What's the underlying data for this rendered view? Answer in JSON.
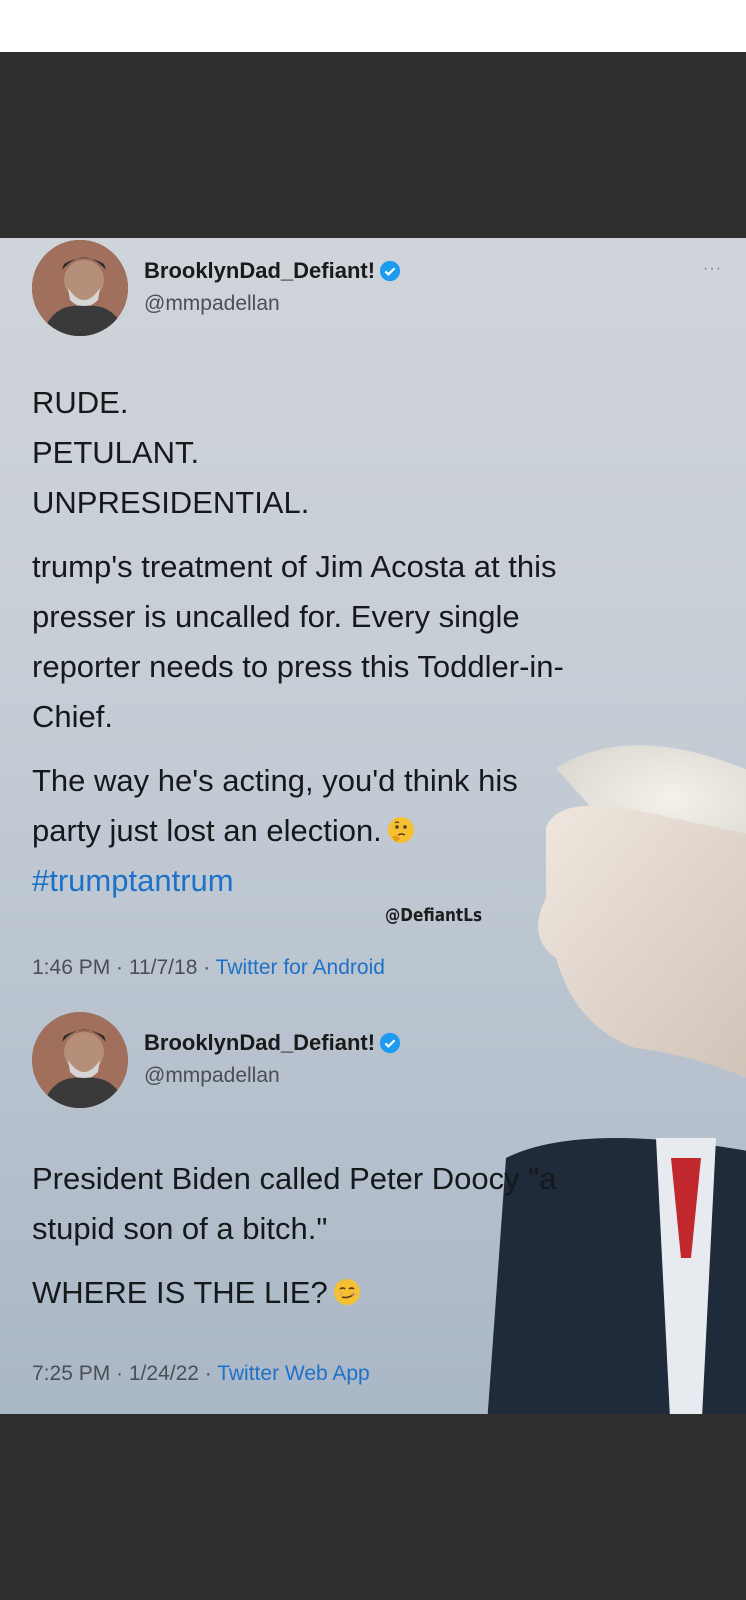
{
  "tweets": [
    {
      "display_name": "BrooklynDad_Defiant!",
      "handle": "@mmpadellan",
      "more": "···",
      "lines": [
        "RUDE.",
        "PETULANT.",
        "UNPRESIDENTIAL.",
        "trump's treatment of Jim Acosta at this",
        "presser is uncalled for. Every single",
        "reporter needs to press this Toddler-in-",
        "Chief.",
        "The way he's acting, you'd think his",
        "party just lost an election."
      ],
      "hashtag": "#trumptantrum",
      "time": "1:46 PM · 11/7/18 · ",
      "source": "Twitter for Android",
      "emoji": "thinking-face-icon"
    },
    {
      "display_name": "BrooklynDad_Defiant!",
      "handle": "@mmpadellan",
      "lines": [
        "President Biden called Peter Doocy \"a",
        "stupid son of a bitch.\"",
        "WHERE IS THE LIE?"
      ],
      "time": "7:25 PM · 1/24/22 · ",
      "source": "Twitter Web App",
      "emoji": "smirking-face-icon"
    }
  ],
  "watermark": "@DefiantLs",
  "colors": {
    "link": "#1d72c8",
    "verified": "#1d9bf0",
    "band": "#2f2f2f"
  }
}
